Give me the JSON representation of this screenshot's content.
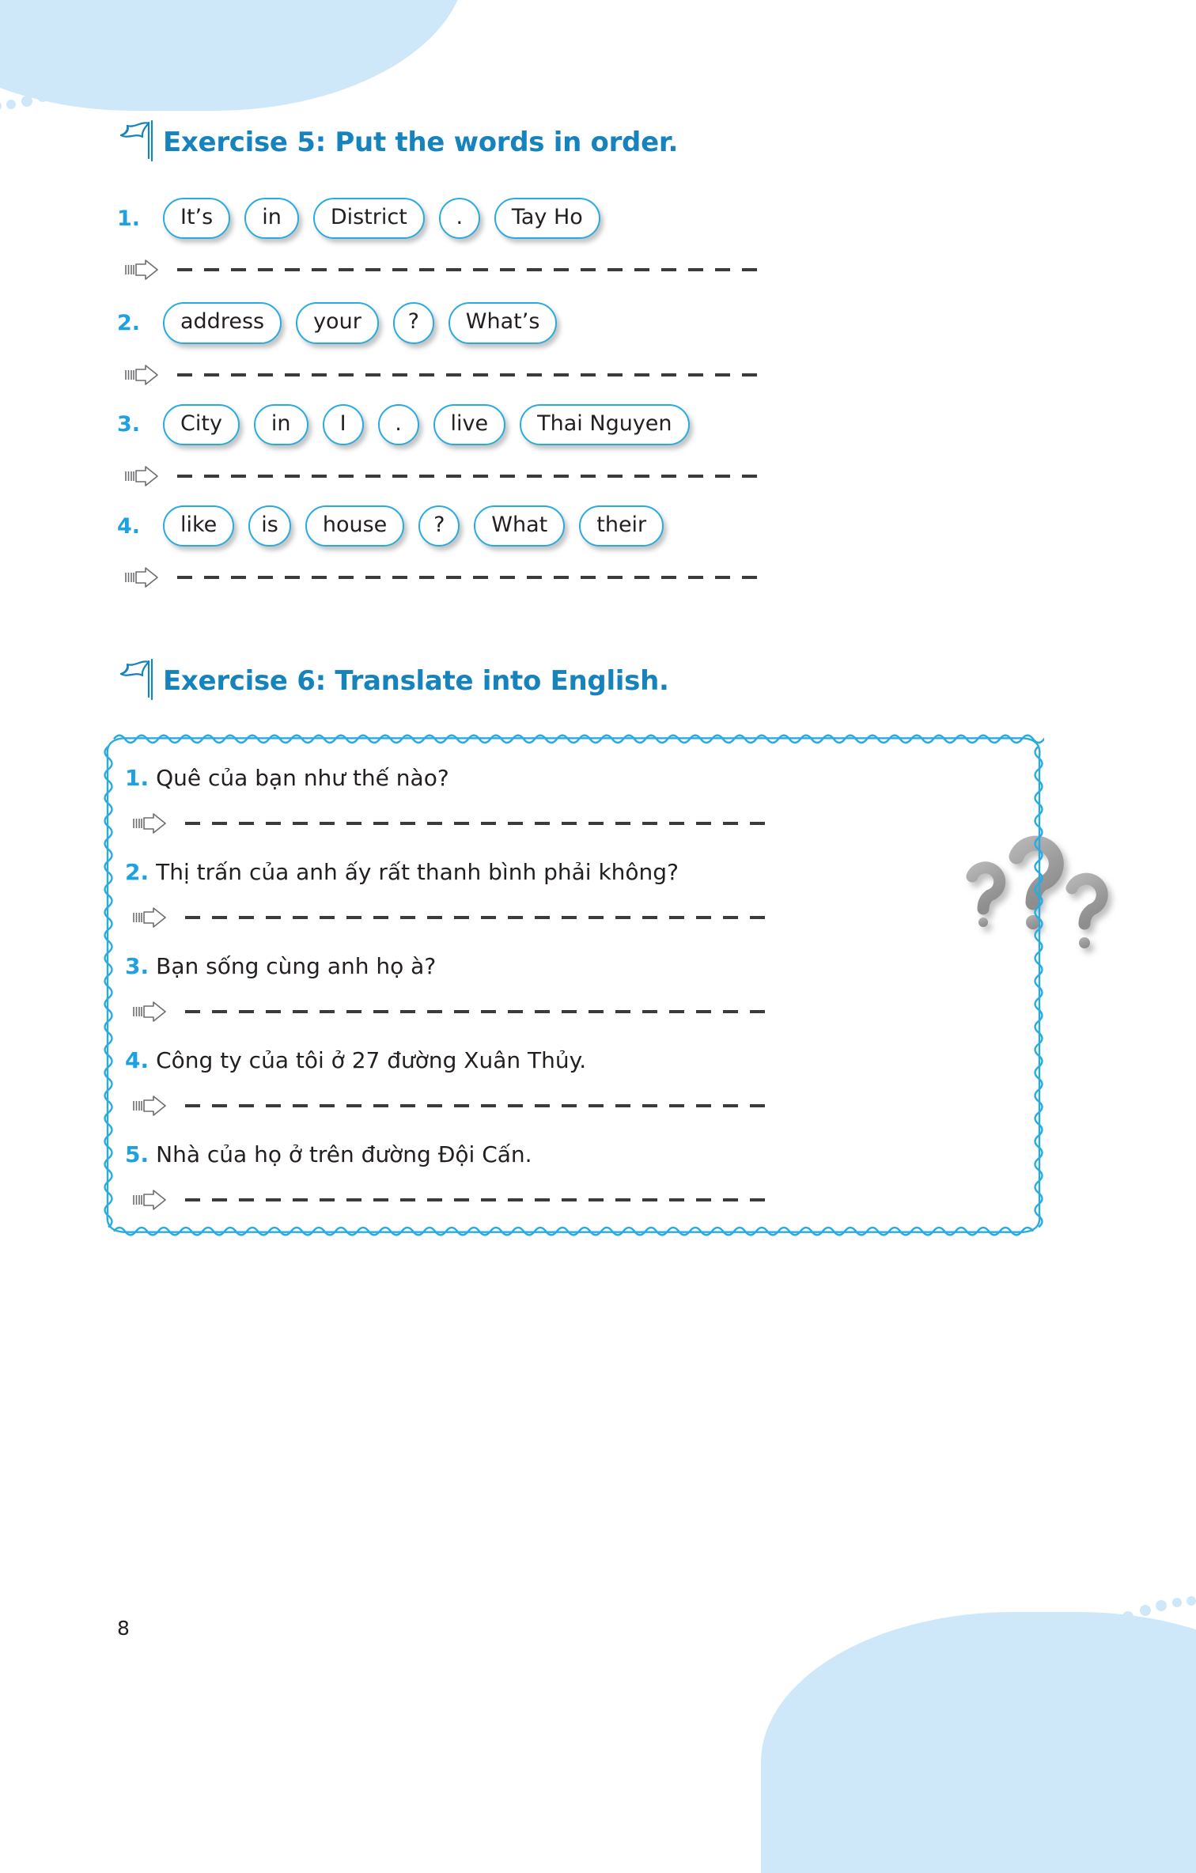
{
  "page": {
    "number": "8"
  },
  "exercise5": {
    "flag_icon": "flag-icon",
    "title": "Exercise 5: Put the words in order.",
    "questions": [
      {
        "number": "1.",
        "words": [
          "It’s",
          "in",
          "District",
          ".",
          "Tay Ho"
        ]
      },
      {
        "number": "2.",
        "words": [
          "address",
          "your",
          "?",
          "What’s"
        ]
      },
      {
        "number": "3.",
        "words": [
          "City",
          "in",
          "I",
          ".",
          "live",
          "Thai Nguyen"
        ]
      },
      {
        "number": "4.",
        "words": [
          "like",
          "is",
          "house",
          "?",
          "What",
          "their"
        ]
      }
    ],
    "answer_arrow_icon": "arrow-right-icon"
  },
  "exercise6": {
    "flag_icon": "flag-icon",
    "title": "Exercise 6: Translate into English.",
    "decoration_icon": "question-marks-icon",
    "questions": [
      {
        "number": "1.",
        "text": "Quê của bạn như thế nào?"
      },
      {
        "number": "2.",
        "text": "Thị trấn của anh ấy rất thanh bình phải không?"
      },
      {
        "number": "3.",
        "text": "Bạn sống cùng anh họ à?"
      },
      {
        "number": "4.",
        "text": "Công ty của tôi ở 27 đường Xuân Thủy."
      },
      {
        "number": "5.",
        "text": "Nhà của họ ở trên đường Đội Cấn."
      }
    ],
    "answer_arrow_icon": "arrow-right-icon"
  },
  "colors": {
    "accent_blue": "#1683bd",
    "chip_border": "#29ABE2",
    "number_blue": "#1da1e0",
    "cloud_blue": "#cfe8f9",
    "question_mark_gray": "#9d9d9d",
    "text_dark": "#231f20"
  }
}
